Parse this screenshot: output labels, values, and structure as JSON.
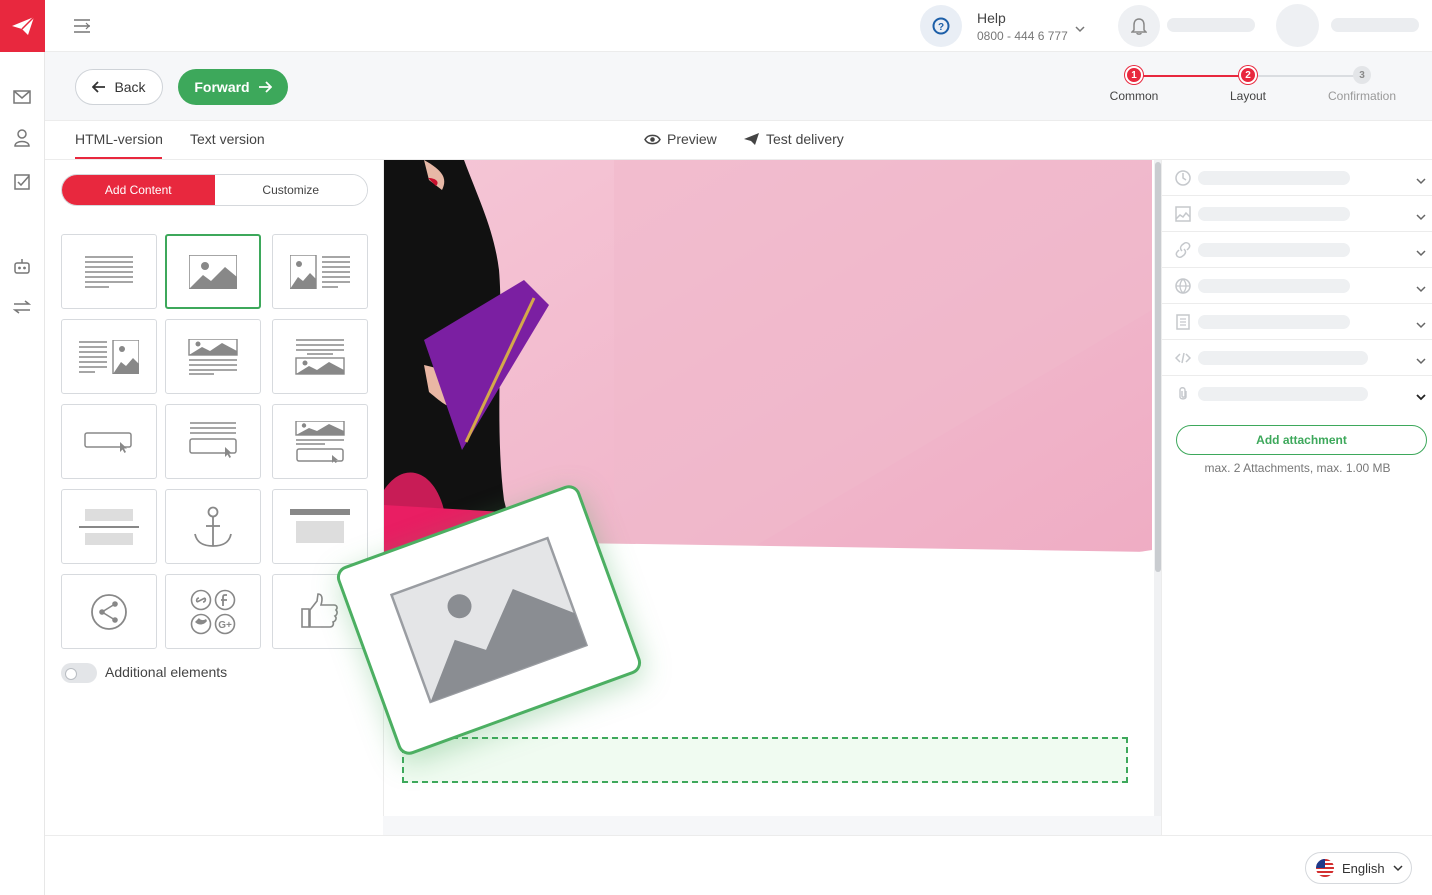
{
  "brand": {
    "accent": "#e8283e",
    "green": "#3da85b"
  },
  "help": {
    "title": "Help",
    "phone": "0800 - 444 6 777"
  },
  "actions": {
    "back_label": "Back",
    "forward_label": "Forward"
  },
  "stepper": {
    "steps": [
      {
        "num": "1",
        "label": "Common",
        "state": "done"
      },
      {
        "num": "2",
        "label": "Layout",
        "state": "active"
      },
      {
        "num": "3",
        "label": "Confirmation",
        "state": "pending"
      }
    ]
  },
  "tabs": {
    "html": "HTML-version",
    "text": "Text version"
  },
  "tools": {
    "preview": "Preview",
    "test_delivery": "Test delivery"
  },
  "segmented": {
    "add_content": "Add Content",
    "customize": "Customize"
  },
  "blocks": [
    "text-block",
    "image-block",
    "image-text-block",
    "text-image-block",
    "image-caption-block",
    "caption-image-block",
    "button-block",
    "text-button-block",
    "image-text-button-block",
    "divider-block",
    "anchor-block",
    "header-block",
    "share-block",
    "social-links-block",
    "like-block"
  ],
  "toggle": {
    "label": "Additional elements"
  },
  "right_panel": {
    "sections": [
      "clock-icon",
      "image-icon",
      "link-icon",
      "globe-icon",
      "document-icon",
      "code-icon",
      "paperclip-icon"
    ],
    "attach_button": "Add attachment",
    "attach_note": "max. 2 Attachments, max. 1.00 MB"
  },
  "footer": {
    "language": "English"
  }
}
